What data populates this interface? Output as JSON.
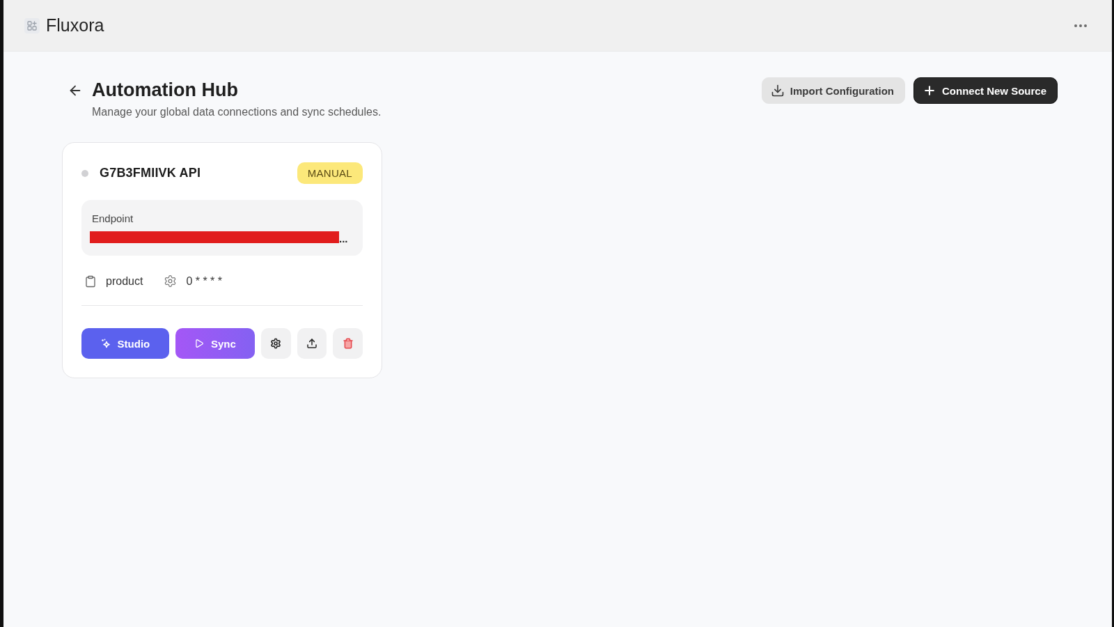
{
  "app": {
    "name": "Fluxora"
  },
  "header": {
    "title": "Automation Hub",
    "subtitle": "Manage your global data connections and sync schedules."
  },
  "actions": [
    {
      "label": "Import Configuration",
      "kind": "import"
    },
    {
      "label": "Connect New Source",
      "kind": "create"
    }
  ],
  "sources": [
    {
      "name": "G7B3FMIIVK API",
      "color": "#d1d1d4",
      "mode": "MANUAL",
      "endpoint": {
        "label": "Endpoint",
        "value": "...",
        "redacted": true
      },
      "target": "product",
      "schedule": "0 * * * *",
      "buttons": [
        {
          "label": "Studio",
          "kind": "studio"
        },
        {
          "label": "Sync",
          "kind": "sync"
        },
        {
          "kind": "settings"
        },
        {
          "kind": "export"
        },
        {
          "kind": "delete"
        }
      ]
    }
  ]
}
